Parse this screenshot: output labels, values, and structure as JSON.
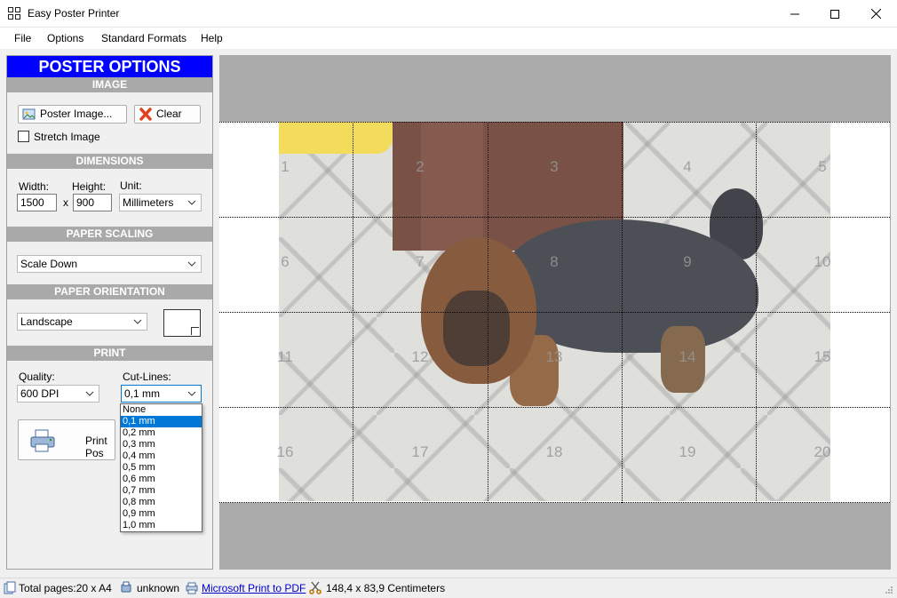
{
  "window": {
    "title": "Easy Poster Printer",
    "controls": {
      "minimize": "—",
      "maximize": "☐",
      "close": "✕"
    }
  },
  "menu": [
    "File",
    "Options",
    "Standard Formats",
    "Help"
  ],
  "panel": {
    "title": "POSTER OPTIONS",
    "sections": {
      "image": "IMAGE",
      "dimensions": "DIMENSIONS",
      "scaling": "PAPER SCALING",
      "orientation": "PAPER ORIENTATION",
      "print": "PRINT"
    },
    "image": {
      "poster_image_btn": "Poster Image...",
      "clear_btn": "Clear",
      "stretch_label": "Stretch Image",
      "stretch_checked": false
    },
    "dimensions": {
      "width_label": "Width:",
      "height_label": "Height:",
      "unit_label": "Unit:",
      "width_value": "1500",
      "height_value": "900",
      "separator": "x",
      "unit_value": "Millimeters"
    },
    "scaling": {
      "value": "Scale Down"
    },
    "orientation": {
      "value": "Landscape"
    },
    "print": {
      "quality_label": "Quality:",
      "quality_value": "600 DPI",
      "cutlines_label": "Cut-Lines:",
      "cutlines_value": "0,1 mm",
      "print_btn": "Print Pos"
    }
  },
  "cutlines_dropdown": {
    "options": [
      "None",
      "0,1 mm",
      "0,2 mm",
      "0,3 mm",
      "0,4 mm",
      "0,5 mm",
      "0,6 mm",
      "0,7 mm",
      "0,8 mm",
      "0,9 mm",
      "1,0 mm"
    ],
    "selected_index": 1
  },
  "preview": {
    "page_numbers": [
      "1",
      "2",
      "3",
      "4",
      "5",
      "6",
      "7",
      "8",
      "9",
      "10",
      "11",
      "12",
      "13",
      "14",
      "15",
      "16",
      "17",
      "18",
      "19",
      "20"
    ]
  },
  "status": {
    "total_pages": "Total pages:20 x A4",
    "paper_type": "unknown",
    "printer": "Microsoft Print to PDF",
    "size": "148,4 x 83,9 Centimeters"
  },
  "colors": {
    "panel_header": "#0000ff",
    "section_header": "#a9a9a9",
    "canvas_bg": "#aaaaaa",
    "selection": "#0078d7"
  }
}
